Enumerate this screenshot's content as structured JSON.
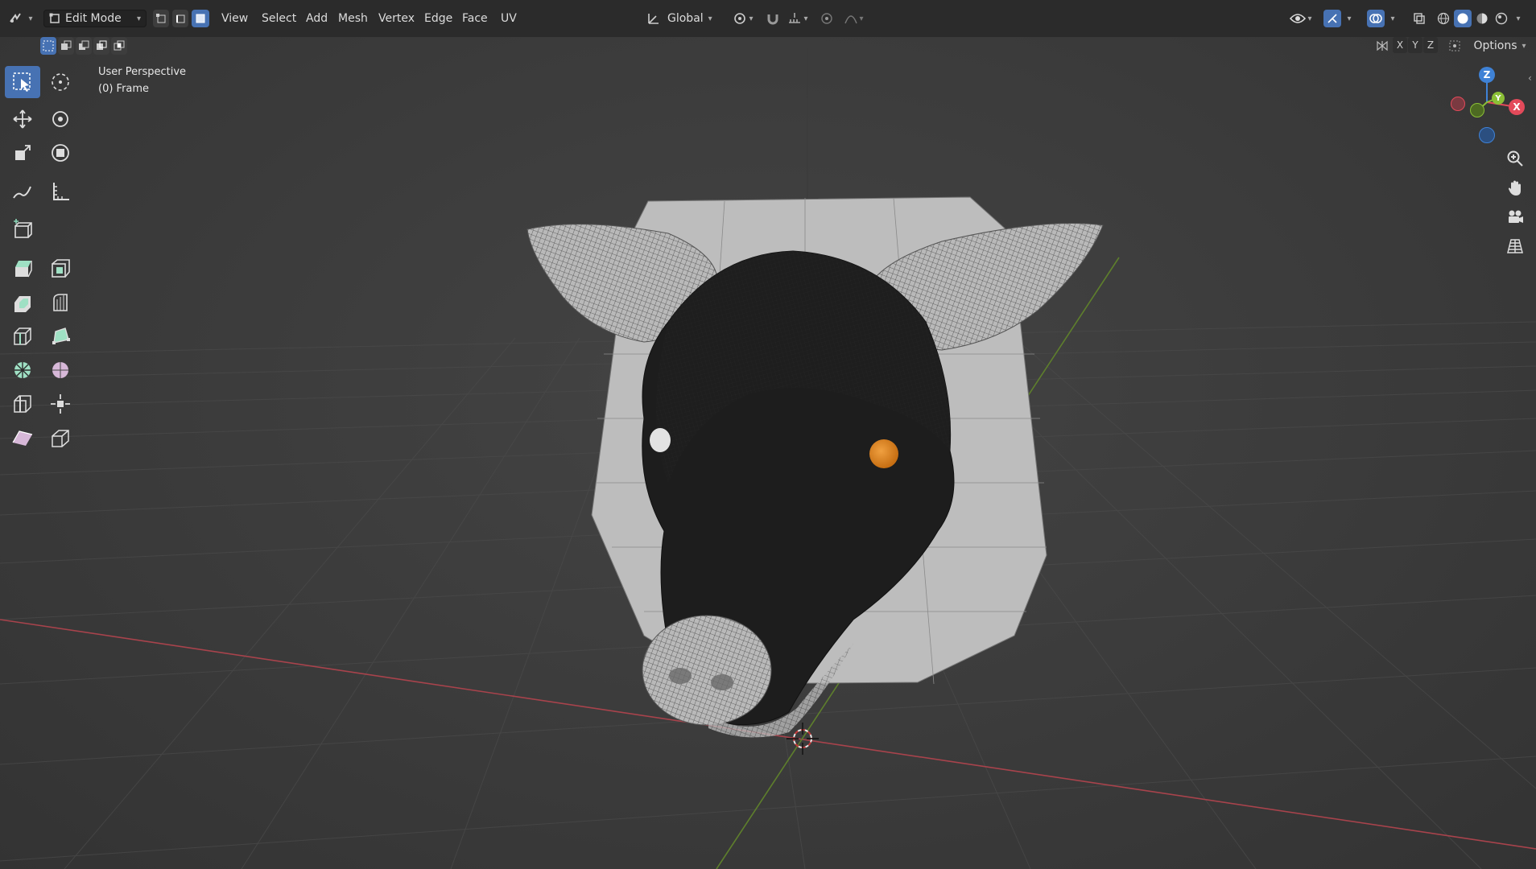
{
  "header": {
    "mode_label": "Edit Mode",
    "menus": [
      "View",
      "Select",
      "Add",
      "Mesh",
      "Vertex",
      "Edge",
      "Face",
      "UV"
    ],
    "orientation_label": "Global",
    "options_label": "Options",
    "axes": [
      "X",
      "Y",
      "Z"
    ]
  },
  "viewport": {
    "perspective_label": "User Perspective",
    "frame_label": "(0) Frame"
  },
  "gizmo": {
    "z_label": "Z",
    "y_label": "Y",
    "x_label": "X"
  },
  "colors": {
    "accent": "#4772b3",
    "x_axis": "#e34a5a",
    "y_axis": "#8bbf36",
    "z_axis": "#3f82d6",
    "eye_selected": "#e08a1e"
  },
  "icons": {
    "toolbar": [
      "select-box-icon",
      "cursor-icon",
      "move-icon",
      "rotate-icon",
      "scale-icon",
      "transform-icon",
      "annotate-icon",
      "measure-icon",
      "add-cube-icon",
      "extrude-region-icon",
      "extrude-manifold-icon",
      "inset-faces-icon",
      "bevel-icon",
      "loop-cut-icon",
      "poly-build-icon",
      "knife-icon",
      "bisect-icon",
      "spin-icon",
      "smooth-vertices-icon",
      "edge-slide-icon",
      "shrink-fatten-icon",
      "shear-icon",
      "rip-region-icon"
    ]
  }
}
